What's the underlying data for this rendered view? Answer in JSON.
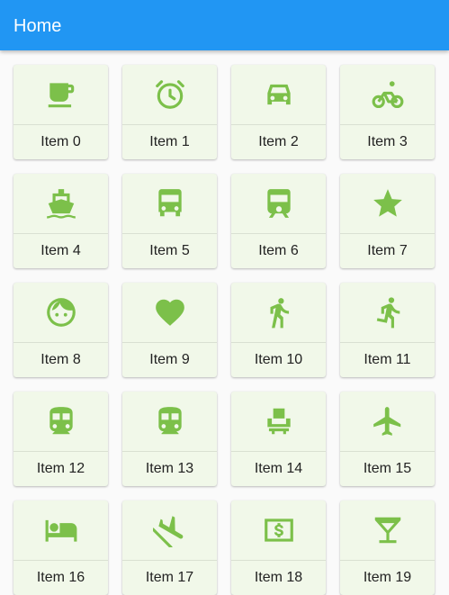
{
  "appbar": {
    "title": "Home",
    "color": "#2196f3"
  },
  "theme": {
    "icon_color": "#7cc04a",
    "card_color": "#f1f8e9"
  },
  "items": [
    {
      "label": "Item 0",
      "icon": "coffee-cup-icon"
    },
    {
      "label": "Item 1",
      "icon": "alarm-clock-icon"
    },
    {
      "label": "Item 2",
      "icon": "car-icon"
    },
    {
      "label": "Item 3",
      "icon": "bicycle-icon"
    },
    {
      "label": "Item 4",
      "icon": "boat-icon"
    },
    {
      "label": "Item 5",
      "icon": "bus-icon"
    },
    {
      "label": "Item 6",
      "icon": "train-icon"
    },
    {
      "label": "Item 7",
      "icon": "star-icon"
    },
    {
      "label": "Item 8",
      "icon": "child-face-icon"
    },
    {
      "label": "Item 9",
      "icon": "heart-icon"
    },
    {
      "label": "Item 10",
      "icon": "walking-person-icon"
    },
    {
      "label": "Item 11",
      "icon": "running-person-icon"
    },
    {
      "label": "Item 12",
      "icon": "subway-icon"
    },
    {
      "label": "Item 13",
      "icon": "tram-icon"
    },
    {
      "label": "Item 14",
      "icon": "seat-icon"
    },
    {
      "label": "Item 15",
      "icon": "airplane-icon"
    },
    {
      "label": "Item 16",
      "icon": "hotel-bed-icon"
    },
    {
      "label": "Item 17",
      "icon": "flight-icon"
    },
    {
      "label": "Item 18",
      "icon": "money-icon"
    },
    {
      "label": "Item 19",
      "icon": "cocktail-glass-icon"
    }
  ]
}
